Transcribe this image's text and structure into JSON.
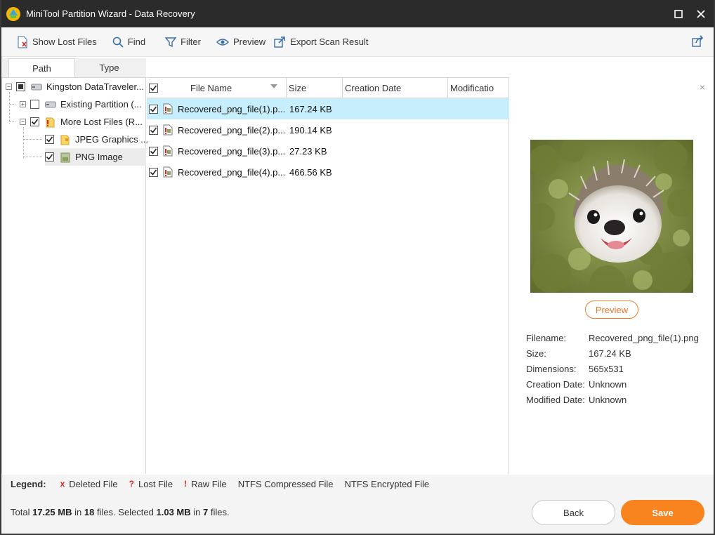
{
  "window": {
    "title": "MiniTool Partition Wizard - Data Recovery",
    "maximize_icon": "maximize-icon",
    "close_icon": "close-icon"
  },
  "toolbar": {
    "show_lost_files": "Show Lost Files",
    "find": "Find",
    "filter": "Filter",
    "preview": "Preview",
    "export_scan_result": "Export Scan Result"
  },
  "tabs": {
    "path": "Path",
    "type": "Type"
  },
  "tree": [
    {
      "label": "Kingston DataTraveler...",
      "icon": "drive-icon",
      "checkbox": "partial",
      "expander": "−"
    },
    {
      "label": "Existing Partition (...",
      "icon": "drive-icon",
      "checkbox": "unchecked",
      "expander": "+"
    },
    {
      "label": "More Lost Files (R...",
      "icon": "raw-folder-icon",
      "checkbox": "checked",
      "expander": "−"
    },
    {
      "label": "JPEG Graphics ...",
      "icon": "folder-icon",
      "checkbox": "checked"
    },
    {
      "label": "PNG Image",
      "icon": "png-image-icon",
      "checkbox": "checked",
      "selected": true
    }
  ],
  "file_list": {
    "columns": [
      "File Name",
      "Size",
      "Creation Date",
      "Modificatio"
    ],
    "rows": [
      {
        "name": "Recovered_png_file(1).p...",
        "size": "167.24 KB",
        "checked": true,
        "selected": true
      },
      {
        "name": "Recovered_png_file(2).p...",
        "size": "190.14 KB",
        "checked": true
      },
      {
        "name": "Recovered_png_file(3).p...",
        "size": "27.23 KB",
        "checked": true
      },
      {
        "name": "Recovered_png_file(4).p...",
        "size": "466.56 KB",
        "checked": true
      }
    ]
  },
  "preview_panel": {
    "button": "Preview",
    "image": "hedgehog-photo",
    "fields": [
      {
        "key": "Filename:",
        "value": "Recovered_png_file(1).png"
      },
      {
        "key": "Size:",
        "value": "167.24 KB"
      },
      {
        "key": "Dimensions:",
        "value": "565x531"
      },
      {
        "key": "Creation Date:",
        "value": "Unknown"
      },
      {
        "key": "Modified Date:",
        "value": "Unknown"
      }
    ]
  },
  "legend": {
    "title": "Legend:",
    "items": [
      {
        "mark": "x",
        "label": "Deleted File"
      },
      {
        "mark": "?",
        "label": "Lost File"
      },
      {
        "mark": "!",
        "label": "Raw File"
      },
      {
        "mark": "",
        "label": "NTFS Compressed File"
      },
      {
        "mark": "",
        "label": "NTFS Encrypted File"
      }
    ]
  },
  "footer": {
    "total_prefix": "Total",
    "total_size": "17.25 MB",
    "in1": "in",
    "total_files": "18",
    "files_selected_prefix": "files.  Selected",
    "selected_size": "1.03 MB",
    "in2": "in",
    "selected_files": "7",
    "files_suffix": "files.",
    "back": "Back",
    "save": "Save"
  },
  "colors": {
    "accent_orange": "#f7841f",
    "selected_row": "#c7eefc",
    "titlebar": "#2b2b2b",
    "legend_mark": "#e0221d"
  }
}
